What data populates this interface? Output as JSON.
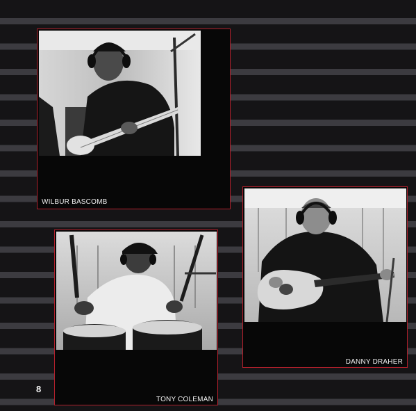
{
  "page": {
    "number": "8",
    "background_color": "#151416",
    "stripe_color": "#3c3b40",
    "frame_color": "#b2202c"
  },
  "photos": [
    {
      "caption": "WILBUR BASCOMB",
      "subject": "bass-player-in-headphones-photo"
    },
    {
      "caption": "TONY COLEMAN",
      "subject": "drummer-in-cap-photo"
    },
    {
      "caption": "DANNY DRAHER",
      "subject": "guitarist-with-electric-bass-photo"
    }
  ]
}
